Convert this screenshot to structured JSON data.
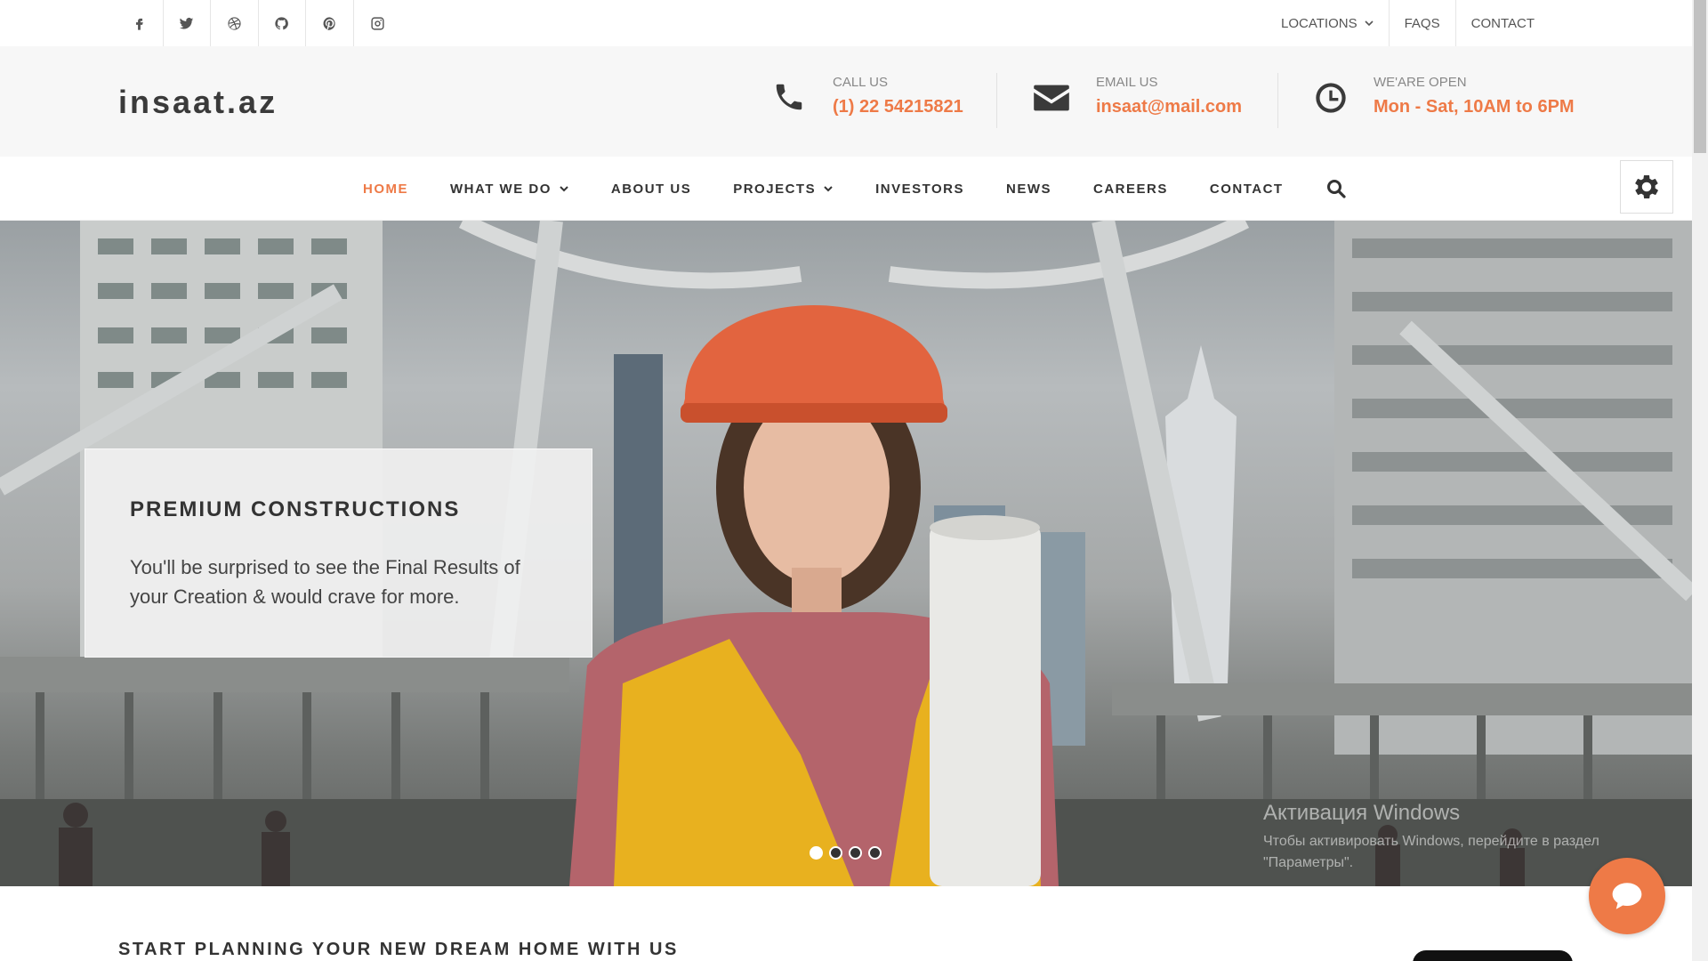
{
  "topbar": {
    "social": [
      "facebook-icon",
      "twitter-icon",
      "dribbble-icon",
      "github-icon",
      "pinterest-icon",
      "instagram-icon"
    ],
    "links": {
      "locations": "LOCATIONS",
      "faqs": "FAQS",
      "contact": "CONTACT"
    }
  },
  "header": {
    "logo": "insaat.az",
    "call": {
      "label": "CALL US",
      "value": "(1) 22 54215821"
    },
    "email": {
      "label": "EMAIL US",
      "value": "insaat@mail.com"
    },
    "hours": {
      "label": "WE'ARE OPEN",
      "value": "Mon - Sat, 10AM to 6PM"
    }
  },
  "nav": {
    "items": [
      "HOME",
      "WHAT WE DO",
      "ABOUT US",
      "PROJECTS",
      "INVESTORS",
      "NEWS",
      "CAREERS",
      "CONTACT"
    ]
  },
  "hero": {
    "title": "PREMIUM CONSTRUCTIONS",
    "text": "You'll be surprised to see the Final Results of your Creation & would crave for more.",
    "slide_count": 4,
    "active_slide": 1
  },
  "watermark": {
    "title": "Активация Windows",
    "line1": "Чтобы активировать Windows, перейдите в раздел",
    "line2": "\"Параметры\"."
  },
  "section": {
    "heading": "START PLANNING YOUR NEW DREAM HOME WITH US"
  },
  "colors": {
    "accent": "#ee7a47",
    "dark": "#333333",
    "header_bg": "#f7f7f7"
  }
}
